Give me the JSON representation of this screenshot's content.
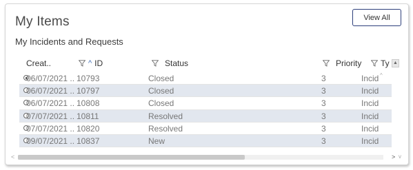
{
  "widget": {
    "title": "My Items",
    "view_all_label": "View All",
    "subtitle": "My Incidents and Requests"
  },
  "columns": [
    {
      "label": "Creat..",
      "filter": false,
      "sort": null
    },
    {
      "label": "ID",
      "filter": true,
      "sort": "asc"
    },
    {
      "label": "Status",
      "filter": true,
      "sort": null
    },
    {
      "label": "Priority",
      "filter": true,
      "sort": null
    },
    {
      "label": "Ty",
      "filter": true,
      "sort": null
    }
  ],
  "rows": [
    {
      "selected": true,
      "created": "06/07/2021 ..",
      "id": "10793",
      "status": "Closed",
      "priority": "3",
      "type": "Incid"
    },
    {
      "selected": false,
      "created": "06/07/2021 ..",
      "id": "10797",
      "status": "Closed",
      "priority": "3",
      "type": "Incid"
    },
    {
      "selected": false,
      "created": "06/07/2021 ..",
      "id": "10808",
      "status": "Closed",
      "priority": "3",
      "type": "Incid"
    },
    {
      "selected": false,
      "created": "07/07/2021 ..",
      "id": "10811",
      "status": "Resolved",
      "priority": "3",
      "type": "Incid"
    },
    {
      "selected": false,
      "created": "07/07/2021 ..",
      "id": "10820",
      "status": "Resolved",
      "priority": "3",
      "type": "Incid"
    },
    {
      "selected": false,
      "created": "09/07/2021 ..",
      "id": "10837",
      "status": "New",
      "priority": "3",
      "type": "Incid"
    }
  ],
  "scroll": {
    "horizontal_position": 0.0,
    "horizontal_visible_fraction": 0.62
  },
  "colors": {
    "alt_row": "#e2e7ef",
    "button_border": "#2c3e7a",
    "sort_arrow": "#3b6ab3"
  },
  "icons": {
    "filter": "funnel-icon",
    "sort_asc": "chevron-up-icon",
    "scroll_left": "chevron-left-icon",
    "scroll_right": "chevron-right-icon",
    "scroll_up": "chevron-up-icon",
    "scroll_down": "chevron-down-icon"
  }
}
